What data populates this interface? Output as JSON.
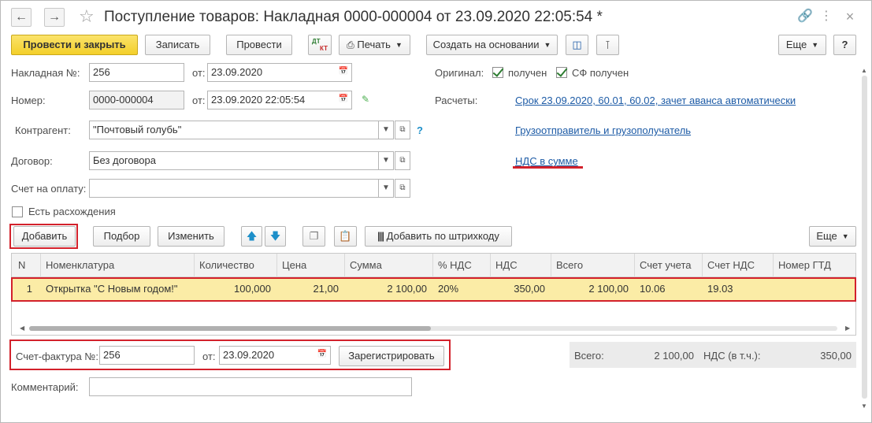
{
  "window": {
    "title": "Поступление товаров: Накладная 0000-000004 от 23.09.2020 22:05:54 *",
    "icons": {
      "back": "arrow-left-icon",
      "forward": "arrow-right-icon",
      "favorite": "star-icon",
      "link": "link-icon",
      "menu": "more-vertical-icon",
      "close": "close-icon"
    }
  },
  "toolbar": {
    "post_close": "Провести и закрыть",
    "save": "Записать",
    "post": "Провести",
    "dtkt_top": "ДТ",
    "dtkt_bottom": "КТ",
    "print": "Печать",
    "create_based": "Создать на основании",
    "more": "Еще",
    "help": "?"
  },
  "header": {
    "invoice_no_label": "Накладная №:",
    "invoice_no_value": "256",
    "from_label": "от:",
    "invoice_date_value": "23.09.2020",
    "number_label": "Номер:",
    "number_value": "0000-000004",
    "number_date_value": "23.09.2020 22:05:54",
    "counterparty_label": "Контрагент:",
    "counterparty_value": "\"Почтовый голубь\"",
    "help_mark": "?",
    "contract_label": "Договор:",
    "contract_value": "Без договора",
    "payment_account_label": "Счет на оплату:",
    "payment_account_value": "",
    "discrepancies_label": "Есть расхождения",
    "original_label": "Оригинал:",
    "received_label": "получен",
    "sf_received_label": "СФ получен",
    "settlements_label": "Расчеты:",
    "settlements_link": "Срок 23.09.2020, 60.01, 60.02, зачет аванса автоматически",
    "shipper_link": "Грузоотправитель и грузополучатель",
    "vat_link": "НДС в сумме"
  },
  "table_toolbar": {
    "add": "Добавить",
    "pick": "Подбор",
    "edit": "Изменить",
    "add_barcode": "Добавить по штрихкоду",
    "more": "Еще"
  },
  "table": {
    "columns": [
      "N",
      "Номенклатура",
      "Количество",
      "Цена",
      "Сумма",
      "% НДС",
      "НДС",
      "Всего",
      "Счет учета",
      "Счет НДС",
      "Номер ГТД"
    ],
    "rows": [
      [
        "1",
        "Открытка \"С Новым годом!\"",
        "100,000",
        "21,00",
        "2 100,00",
        "20%",
        "350,00",
        "2 100,00",
        "10.06",
        "19.03",
        ""
      ]
    ]
  },
  "footer": {
    "sf_label": "Счет-фактура №:",
    "sf_value": "256",
    "sf_from_label": "от:",
    "sf_date_value": "23.09.2020",
    "register": "Зарегистрировать",
    "total_label": "Всего:",
    "total_value": "2 100,00",
    "vat_incl_label": "НДС (в т.ч.):",
    "vat_incl_value": "350,00",
    "comment_label": "Комментарий:",
    "comment_value": ""
  },
  "colors": {
    "primary_button": "#f3cf2a",
    "selected_row": "#fbeca6",
    "link": "#1d5ba6",
    "highlight": "#d3212b",
    "check": "#2e7d32"
  }
}
